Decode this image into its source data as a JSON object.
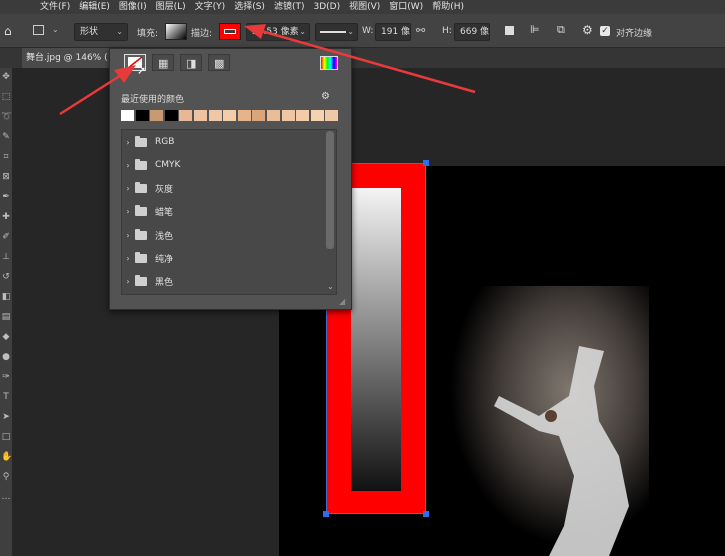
{
  "menu": [
    "文件(F)",
    "编辑(E)",
    "图像(I)",
    "图层(L)",
    "文字(Y)",
    "选择(S)",
    "滤镜(T)",
    "3D(D)",
    "视图(V)",
    "窗口(W)",
    "帮助(H)"
  ],
  "options_bar": {
    "tool_mode": "形状",
    "fill_label": "填充:",
    "stroke_label": "描边:",
    "stroke_width": "57.53 像素",
    "w_label": "W:",
    "w_value": "191 像",
    "h_label": "H:",
    "h_value": "669 像",
    "align_edges_label": "对齐边缘",
    "align_edges_checked": true
  },
  "document_tab": "舞台.jpg @ 146% (",
  "swatch_popup": {
    "recent_label": "最近使用的颜色",
    "recent_colors": [
      "#ffffff",
      "#000000",
      "#c89a72",
      "#000000",
      "#e8b896",
      "#eec3a2",
      "#f0c7a6",
      "#f3cca9",
      "#e6b48c",
      "#dba57c",
      "#e9bd98",
      "#efc6a3",
      "#f2cba8",
      "#f5d2b0",
      "#f0c8a5"
    ],
    "folders": [
      "RGB",
      "CMYK",
      "灰度",
      "蜡笔",
      "浅色",
      "纯净",
      "黑色"
    ]
  },
  "accent": "#ff0000",
  "annotation_color": "#e83a3a"
}
